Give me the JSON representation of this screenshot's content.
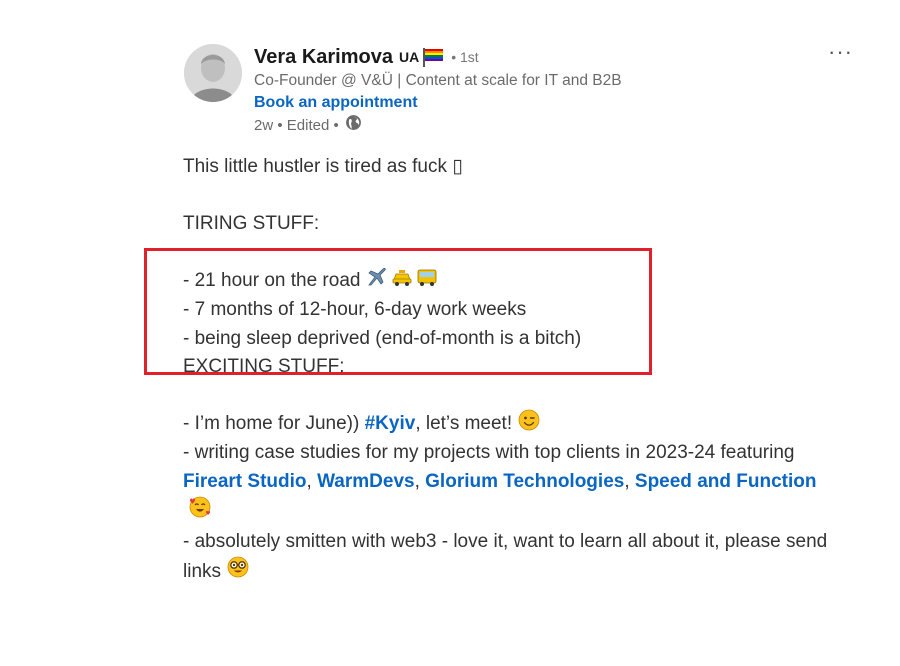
{
  "author": {
    "name": "Vera Karimova",
    "country_badge": "UA",
    "degree": "• 1st",
    "headline": "Co-Founder @ V&Ü | Content at scale for IT and B2B",
    "cta_link": "Book an appointment",
    "meta": "2w • Edited •",
    "meta_icon": "globe-icon"
  },
  "menu": {
    "more_label": "···"
  },
  "post": {
    "intro": "This little hustler is tired as fuck ▯",
    "tiring_heading": "TIRING STUFF:",
    "tiring_items": [
      "- 21 hour on the road",
      "- 7 months of 12-hour, 6-day work weeks",
      "- being sleep deprived (end-of-month is a bitch)"
    ],
    "tiring_emojis": [
      "airplane-emoji",
      "taxi-emoji",
      "bus-emoji"
    ],
    "exciting_heading": "EXCITING STUFF:",
    "exciting_1_pre": "- I’m home for June)) ",
    "exciting_1_tag": "#Kyiv",
    "exciting_1_post": ", let’s meet!",
    "exciting_2_pre": "- writing case studies for my projects with top clients in 2023-24 featuring ",
    "mentions": [
      "Fireart Studio",
      "WarmDevs",
      "Glorium Technologies",
      "Speed and Function"
    ],
    "exciting_3": "- absolutely smitten with web3 - love it, want to learn all about it, please send links"
  },
  "colors": {
    "link": "#0a66c2",
    "highlight_border": "#e0202a",
    "text": "#333333"
  }
}
